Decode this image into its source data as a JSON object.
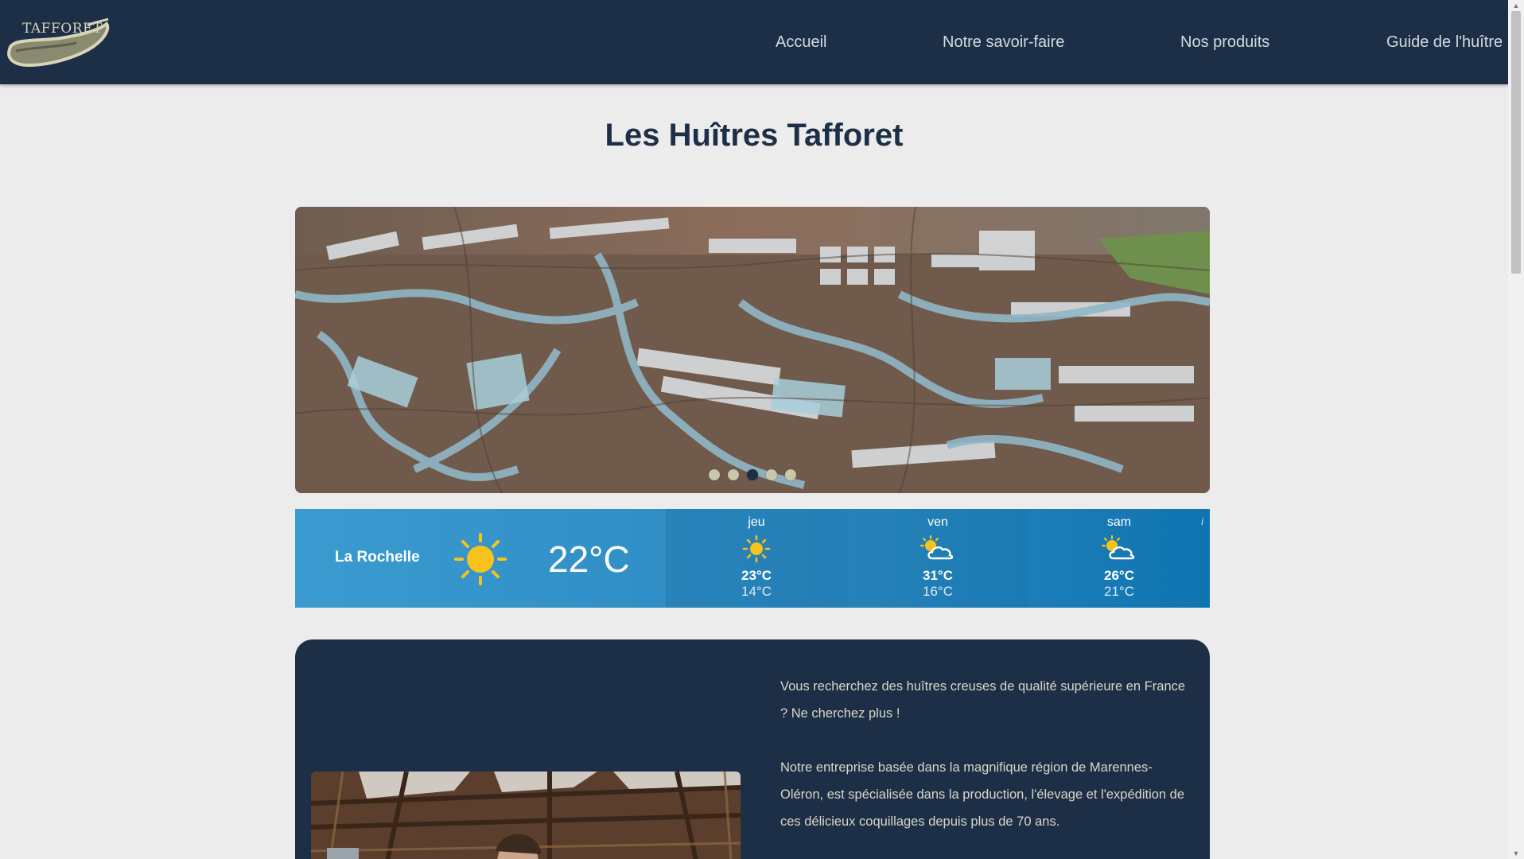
{
  "brand": {
    "logo_text": "TAFFORET"
  },
  "nav": {
    "items": [
      {
        "label": "Accueil"
      },
      {
        "label": "Notre savoir-faire"
      },
      {
        "label": "Nos produits"
      },
      {
        "label": "Guide de l'huître"
      }
    ]
  },
  "page": {
    "title": "Les Huîtres Tafforet"
  },
  "carousel": {
    "slide_count": 5,
    "active_index": 2
  },
  "weather": {
    "city": "La Rochelle",
    "current_temp": "22°C",
    "current_icon": "sun-icon",
    "forecast": [
      {
        "day": "jeu",
        "high": "23°C",
        "low": "14°C",
        "icon": "sun-icon"
      },
      {
        "day": "ven",
        "high": "31°C",
        "low": "16°C",
        "icon": "sun-cloud-icon"
      },
      {
        "day": "sam",
        "high": "26°C",
        "low": "21°C",
        "icon": "sun-cloud-icon"
      }
    ],
    "info": "i"
  },
  "intro": {
    "paragraphs": [
      "Vous recherchez des huîtres creuses de qualité supérieure en France ? Ne cherchez plus !",
      "Notre entreprise basée dans la magnifique région de Marennes-Oléron, est spécialisée dans la production, l'élevage et l'expédition de ces délicieux coquillages depuis plus de 70 ans."
    ]
  },
  "colors": {
    "header_bg": "#1d2f47",
    "page_bg": "#ececec",
    "accent_text": "#d9d7c6",
    "weather_bg": "#2a88c0"
  }
}
